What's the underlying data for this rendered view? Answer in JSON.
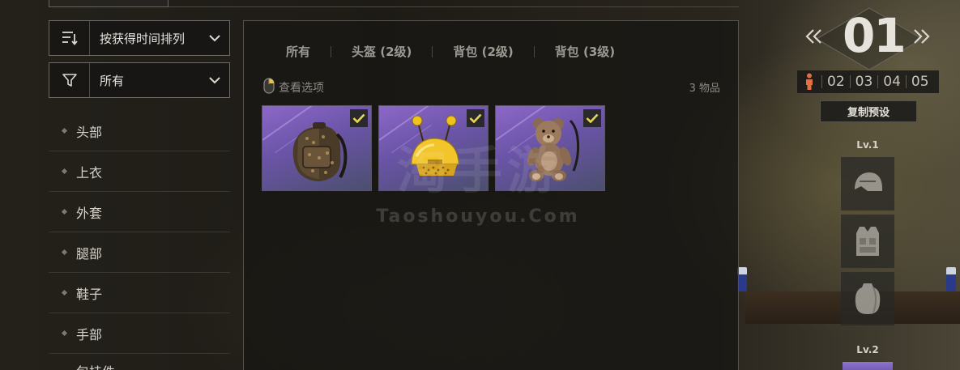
{
  "sort_dropdown": {
    "label": "按获得时间排列",
    "icon": "sort-icon"
  },
  "filter_dropdown": {
    "label": "所有",
    "icon": "filter-icon"
  },
  "categories": [
    {
      "label": "头部"
    },
    {
      "label": "上衣"
    },
    {
      "label": "外套"
    },
    {
      "label": "腿部"
    },
    {
      "label": "鞋子"
    },
    {
      "label": "手部"
    },
    {
      "label": "包挂件"
    }
  ],
  "tabs": [
    {
      "label": "所有"
    },
    {
      "label": "头盔 (2级)"
    },
    {
      "label": "背包 (2级)"
    },
    {
      "label": "背包 (3级)"
    }
  ],
  "view_options_label": "查看选项",
  "item_count_label": "3 物品",
  "items": [
    {
      "name": "backpack",
      "selected": true
    },
    {
      "name": "helmet-antennae",
      "selected": true
    },
    {
      "name": "teddy-bear-backpack",
      "selected": true
    }
  ],
  "watermark": {
    "main": "淘手游",
    "sub": "Taoshouyou.Com"
  },
  "preset": {
    "current": "01",
    "slots": [
      "02",
      "03",
      "04",
      "05"
    ],
    "copy_label": "复制预设",
    "lv1_label": "Lv.1",
    "lv2_label": "Lv.2"
  },
  "colors": {
    "accent": "#e06f45",
    "check": "#e8d84a",
    "item_bg": "#7a5fc0"
  }
}
